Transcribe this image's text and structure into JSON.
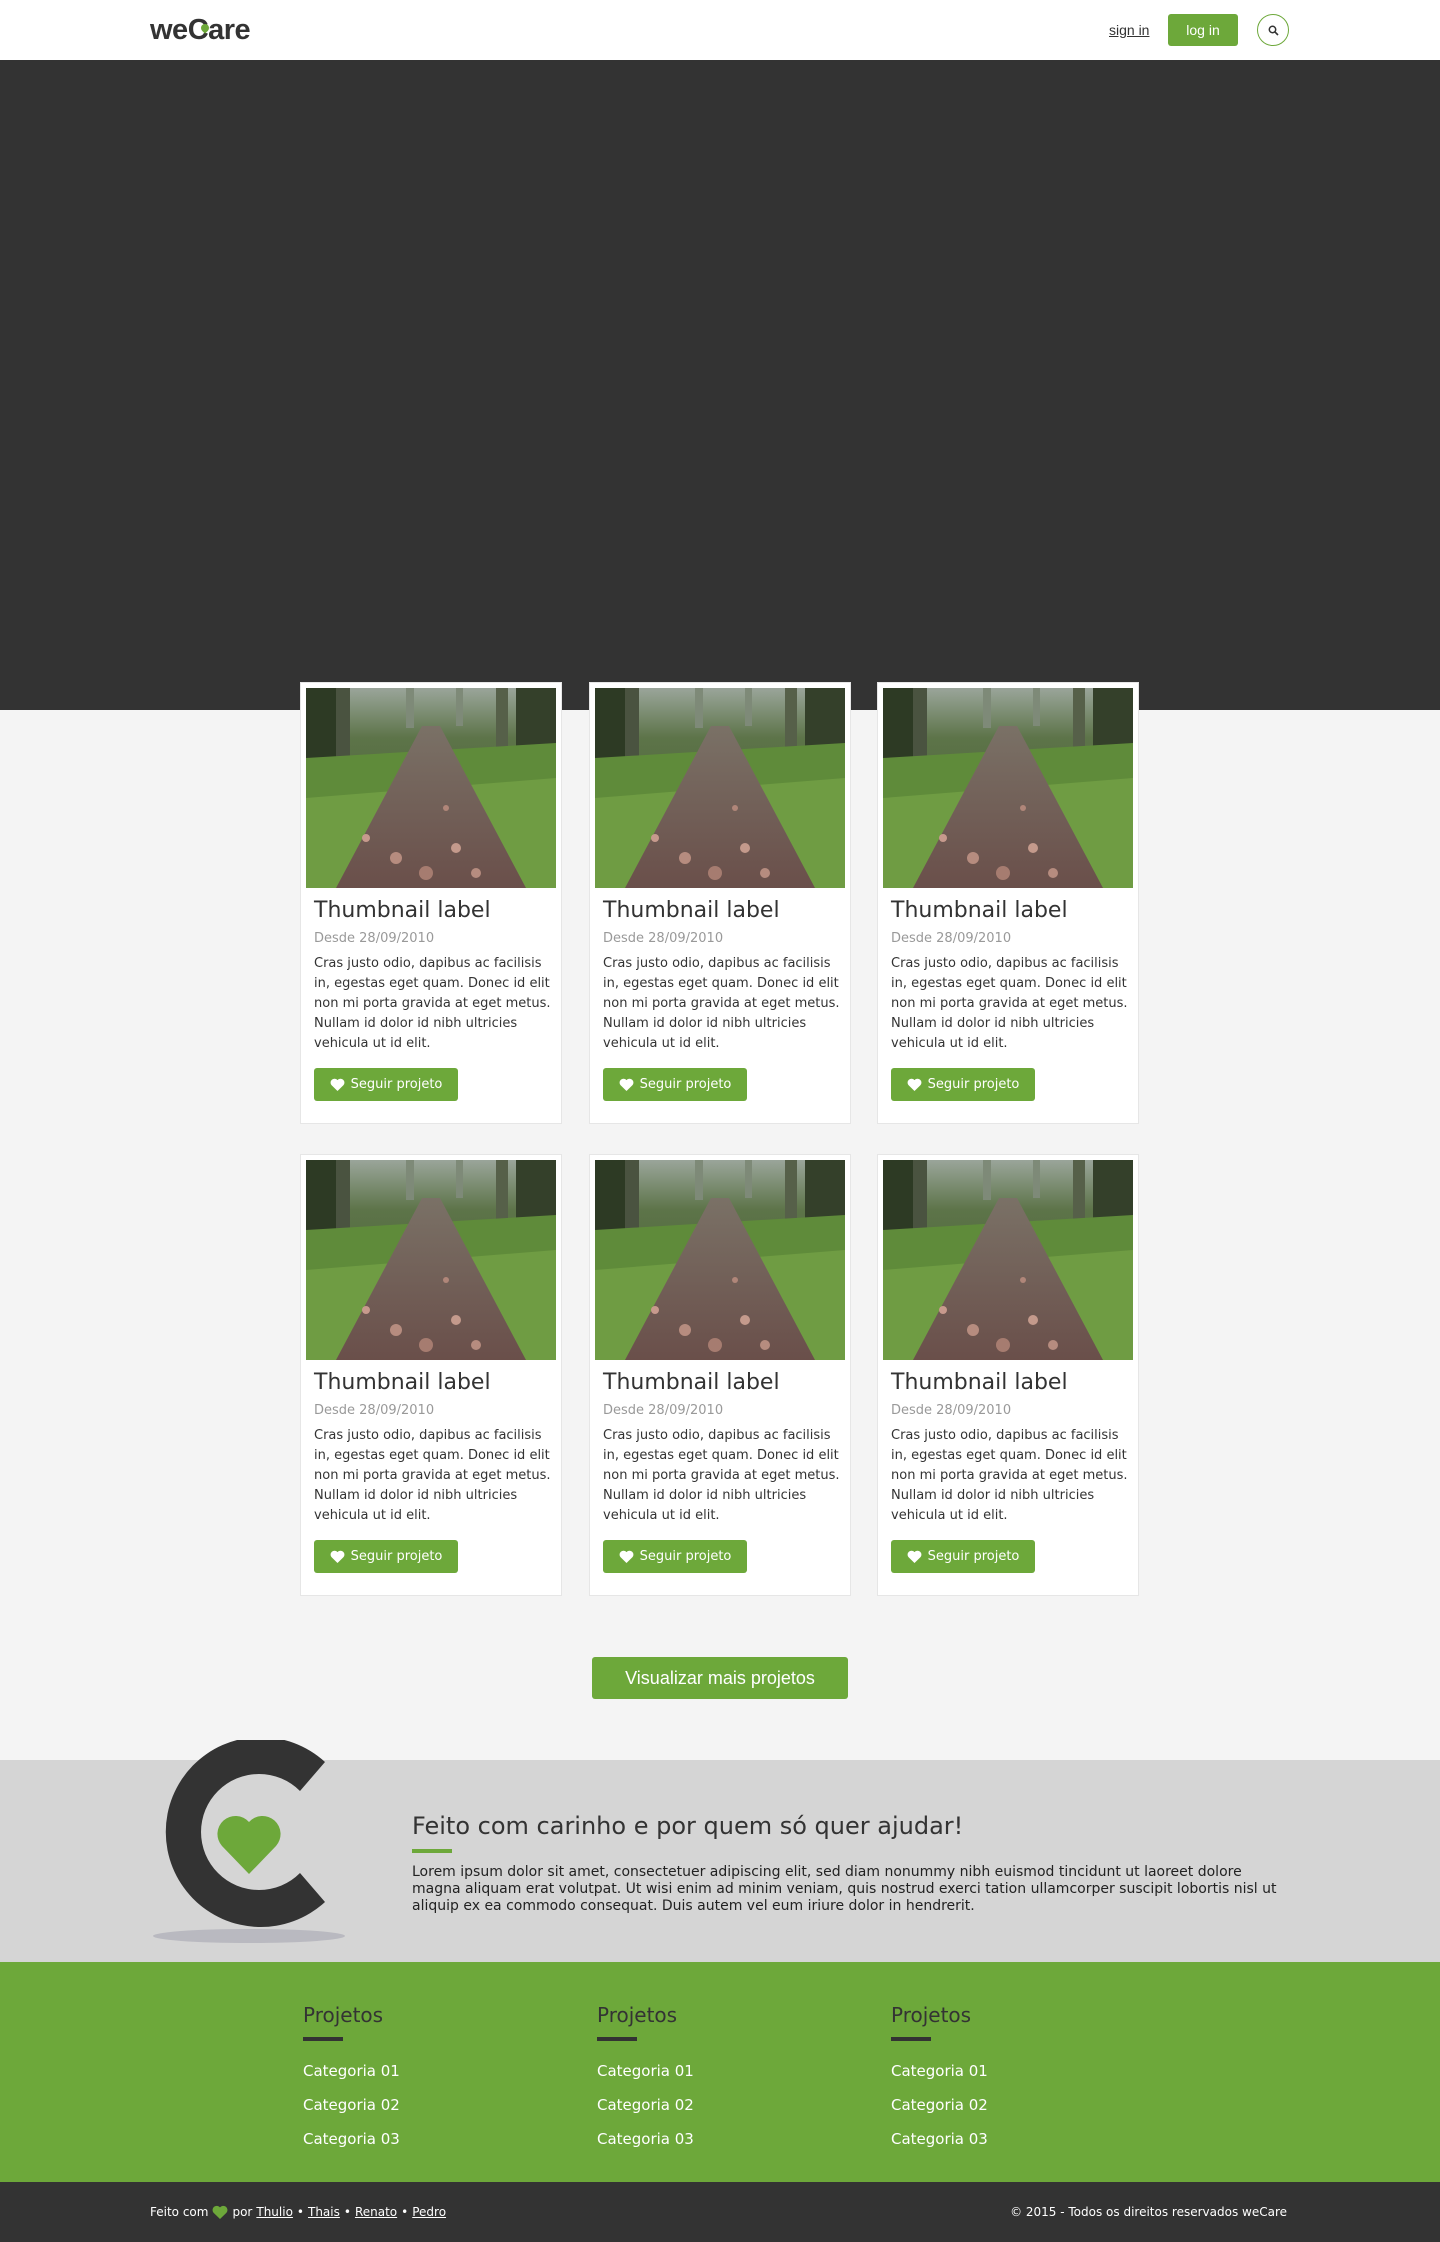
{
  "header": {
    "logo": {
      "prefix": "we",
      "c": "C",
      "suffix": "are"
    },
    "signin_label": "sign in",
    "login_label": "log in",
    "search_icon": "search-icon"
  },
  "cards": [
    {
      "title": "Thumbnail label",
      "date": "Desde 28/09/2010",
      "desc": "Cras justo odio, dapibus ac facilisis in, egestas eget quam. Donec id elit non mi porta gravida at eget metus. Nullam id dolor id nibh ultricies vehicula ut id elit.",
      "button": "Seguir projeto"
    },
    {
      "title": "Thumbnail label",
      "date": "Desde 28/09/2010",
      "desc": "Cras justo odio, dapibus ac facilisis in, egestas eget quam. Donec id elit non mi porta gravida at eget metus. Nullam id dolor id nibh ultricies vehicula ut id elit.",
      "button": "Seguir projeto"
    },
    {
      "title": "Thumbnail label",
      "date": "Desde 28/09/2010",
      "desc": "Cras justo odio, dapibus ac facilisis in, egestas eget quam. Donec id elit non mi porta gravida at eget metus. Nullam id dolor id nibh ultricies vehicula ut id elit.",
      "button": "Seguir projeto"
    },
    {
      "title": "Thumbnail label",
      "date": "Desde 28/09/2010",
      "desc": "Cras justo odio, dapibus ac facilisis in, egestas eget quam. Donec id elit non mi porta gravida at eget metus. Nullam id dolor id nibh ultricies vehicula ut id elit.",
      "button": "Seguir projeto"
    },
    {
      "title": "Thumbnail label",
      "date": "Desde 28/09/2010",
      "desc": "Cras justo odio, dapibus ac facilisis in, egestas eget quam. Donec id elit non mi porta gravida at eget metus. Nullam id dolor id nibh ultricies vehicula ut id elit.",
      "button": "Seguir projeto"
    },
    {
      "title": "Thumbnail label",
      "date": "Desde 28/09/2010",
      "desc": "Cras justo odio, dapibus ac facilisis in, egestas eget quam. Donec id elit non mi porta gravida at eget metus. Nullam id dolor id nibh ultricies vehicula ut id elit.",
      "button": "Seguir projeto"
    }
  ],
  "more_button": "Visualizar mais projetos",
  "about": {
    "title": "Feito com carinho e por quem só quer ajudar!",
    "text": "Lorem ipsum dolor sit amet, consectetuer adipiscing elit, sed diam nonummy nibh euismod tincidunt ut laoreet dolore magna aliquam erat volutpat. Ut wisi enim ad minim veniam, quis nostrud exerci tation ullamcorper suscipit lobortis nisl ut aliquip ex ea commodo consequat. Duis autem vel eum iriure dolor in hendrerit."
  },
  "footer_columns": [
    {
      "title": "Projetos",
      "links": [
        "Categoria 01",
        "Categoria 02",
        "Categoria 03"
      ]
    },
    {
      "title": "Projetos",
      "links": [
        "Categoria 01",
        "Categoria 02",
        "Categoria 03"
      ]
    },
    {
      "title": "Projetos",
      "links": [
        "Categoria 01",
        "Categoria 02",
        "Categoria 03"
      ]
    }
  ],
  "bottom": {
    "made_with": "Feito com",
    "by": "por",
    "authors": [
      "Thulio",
      "Thais",
      "Renato",
      "Pedro"
    ],
    "separator": "•",
    "copyright": "© 2015 - Todos os direitos reservados weCare"
  },
  "colors": {
    "accent": "#6da83a",
    "dark": "#333333",
    "light_gray": "#f4f4f4",
    "strip_gray": "#d5d5d5"
  }
}
